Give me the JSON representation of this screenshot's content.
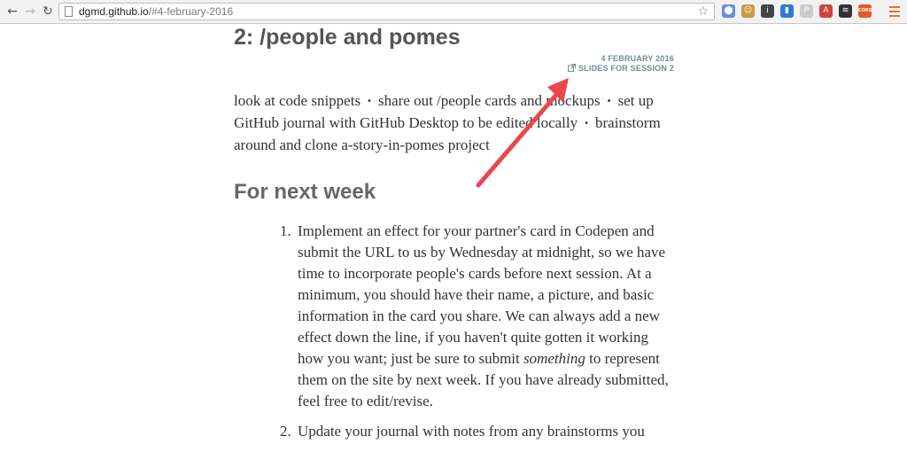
{
  "browser": {
    "url_host": "dgmd.github.io",
    "url_path": "/#4-february-2016",
    "back_glyph": "←",
    "forward_glyph": "→",
    "reload_glyph": "↻",
    "star_glyph": "☆",
    "extensions": [
      {
        "icon": "ghost-icon",
        "color": "#6a8fd8",
        "glyph": "⬤"
      },
      {
        "icon": "face-icon",
        "color": "#c89a46",
        "glyph": "☺"
      },
      {
        "icon": "info-icon",
        "color": "#444444",
        "glyph": "i"
      },
      {
        "icon": "trello-icon",
        "color": "#2c7bd1",
        "glyph": "▮"
      },
      {
        "icon": "pushbullet-icon",
        "color": "#cccccc",
        "glyph": "P"
      },
      {
        "icon": "anarchy-icon",
        "color": "#d0453a",
        "glyph": "A"
      },
      {
        "icon": "buffer-icon",
        "color": "#333333",
        "glyph": "≋"
      },
      {
        "icon": "cors-icon",
        "color": "#e05a2a",
        "glyph": "CORS"
      }
    ]
  },
  "page": {
    "session_title": "2: /people and pomes",
    "date": "4 FEBRUARY 2016",
    "slides_link": "SLIDES FOR SESSION 2",
    "bullet": "•",
    "agenda": [
      "look at code snippets",
      "share out /people cards and mockups",
      "set up GitHub journal with GitHub Desktop to be edited locally",
      "brainstorm around and clone a-story-in-pomes project"
    ],
    "next_week_heading": "For next week",
    "tasks": [
      {
        "num": "1.",
        "before": "Implement an effect for your partner's card in Codepen and submit the URL to us by Wednesday at midnight, so we have time to incorporate people's cards before next session. At a minimum, you should have their name, a picture, and basic information in the card you share. We can always add a new effect down the line, if you haven't quite gotten it working how you want; just be sure to submit ",
        "emphasis": "something",
        "after": " to represent them on the site by next week. If you have already submitted, feel free to edit/revise."
      },
      {
        "num": "2.",
        "before": "Update your journal with notes from any brainstorms you",
        "emphasis": "",
        "after": ""
      }
    ],
    "annotation_color": "#e8474d"
  }
}
